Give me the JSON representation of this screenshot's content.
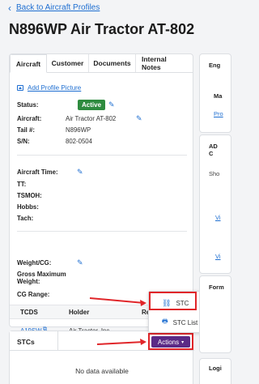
{
  "nav": {
    "back_label": "Back to Aircraft Profiles"
  },
  "page": {
    "title": "N896WP Air Tractor AT-802"
  },
  "tabs": [
    "Aircraft",
    "Customer",
    "Documents",
    "Internal Notes"
  ],
  "profile": {
    "add_picture": "Add Profile Picture",
    "status_label": "Status:",
    "status_value": "Active",
    "aircraft_label": "Aircraft:",
    "aircraft_value": "Air Tractor AT-802",
    "tail_label": "Tail #:",
    "tail_value": "N896WP",
    "sn_label": "S/N:",
    "sn_value": "802-0504",
    "aircraft_time_label": "Aircraft Time:",
    "tt_label": "TT:",
    "tsmoh_label": "TSMOH:",
    "hobbs_label": "Hobbs:",
    "tach_label": "Tach:",
    "weight_label": "Weight/CG:",
    "gross_label": "Gross Maximum Weight:",
    "cg_label": "CG Range:"
  },
  "tcds_table": {
    "headers": [
      "TCDS",
      "Holder",
      "Rev"
    ],
    "rows": [
      {
        "tcds": "A19SW",
        "holder": "Air Tractor, Inc."
      }
    ]
  },
  "stcs": {
    "title": "STCs",
    "empty": "No data available",
    "actions_label": "Actions"
  },
  "actions_menu": [
    "STC",
    "STC List"
  ],
  "right_panel": {
    "eng": "Eng",
    "ma": "Ma",
    "pro": "Pro",
    "ad": "AD C",
    "sho": "Sho",
    "vi1": "Vi",
    "vi2": "Vi",
    "form": "Form",
    "logi": "Logi"
  },
  "colors": {
    "link": "#1f6fd1",
    "active_badge": "#2e8b3f",
    "actions_button": "#5b2a86",
    "annotation": "#e0262a"
  }
}
